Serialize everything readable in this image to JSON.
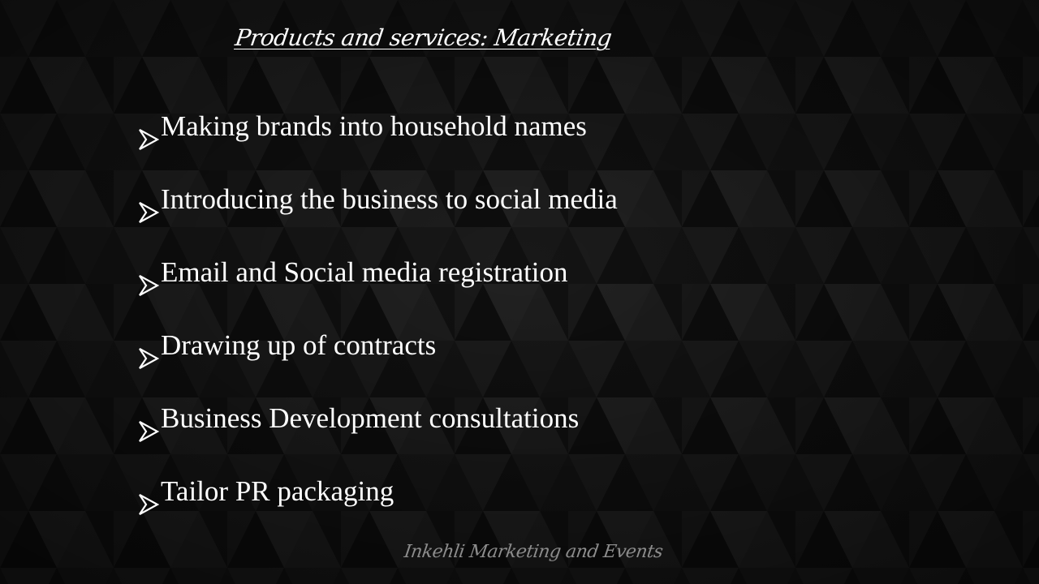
{
  "slide": {
    "title": "Products and services: Marketing",
    "bullets": [
      {
        "text": "Making brands into household names"
      },
      {
        "text": "Introducing the business to social media"
      },
      {
        "text": "Email and Social media registration"
      },
      {
        "text": "Drawing up of contracts"
      },
      {
        "text": "Business Development consultations"
      },
      {
        "text": "Tailor PR packaging"
      }
    ],
    "bullet_icon": "arrowhead-bullet-icon",
    "footer": "Inkehli Marketing and Events"
  },
  "colors": {
    "background": "#141414",
    "text": "#ffffff",
    "footer_text": "#8c8c8c"
  }
}
